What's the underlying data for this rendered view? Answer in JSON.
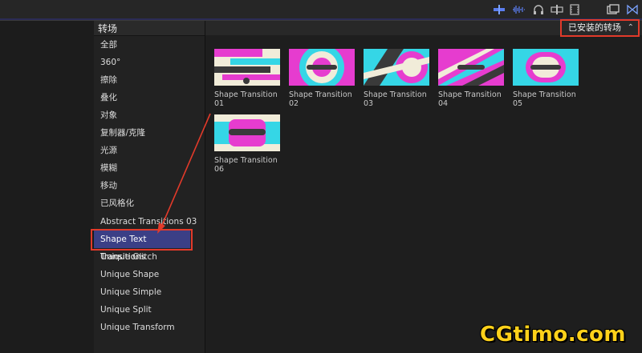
{
  "panel": {
    "title": "转场"
  },
  "installed_dropdown": {
    "label": "已安装的转场",
    "chevron": "⌃⌄"
  },
  "categories": [
    {
      "label": "全部"
    },
    {
      "label": "360°"
    },
    {
      "label": "擦除"
    },
    {
      "label": "叠化"
    },
    {
      "label": "对象"
    },
    {
      "label": "复制器/克隆"
    },
    {
      "label": "光源"
    },
    {
      "label": "模糊"
    },
    {
      "label": "移动"
    },
    {
      "label": "已风格化"
    },
    {
      "label": "Abstract Transitions 03"
    },
    {
      "label": "Shape Text Transitions"
    },
    {
      "label": "Unique Glitch"
    },
    {
      "label": "Unique Shape"
    },
    {
      "label": "Unique Simple"
    },
    {
      "label": "Unique Split"
    },
    {
      "label": "Unique Transform"
    }
  ],
  "selected_category": "Shape Text Transitions",
  "transitions": [
    {
      "name": "Shape Transition",
      "num": "01"
    },
    {
      "name": "Shape Transition",
      "num": "02"
    },
    {
      "name": "Shape Transition",
      "num": "03"
    },
    {
      "name": "Shape Transition",
      "num": "04"
    },
    {
      "name": "Shape Transition",
      "num": "05"
    },
    {
      "name": "Shape Transition",
      "num": "06"
    }
  ],
  "watermark": "CGtimo.com",
  "toolbar_icons": [
    "audio-meter-icon",
    "waveform-icon",
    "headphones-icon",
    "clip-skimming-icon",
    "film-icon",
    "browser-window-icon",
    "inspector-icon"
  ],
  "colors": {
    "accent": "#3b3f86",
    "highlight": "#e23a2a",
    "magenta": "#e63ccf",
    "cyan": "#35d6e6",
    "cream": "#f1ecd9",
    "dark": "#3a3a3a",
    "watermark": "#ffd11a"
  }
}
